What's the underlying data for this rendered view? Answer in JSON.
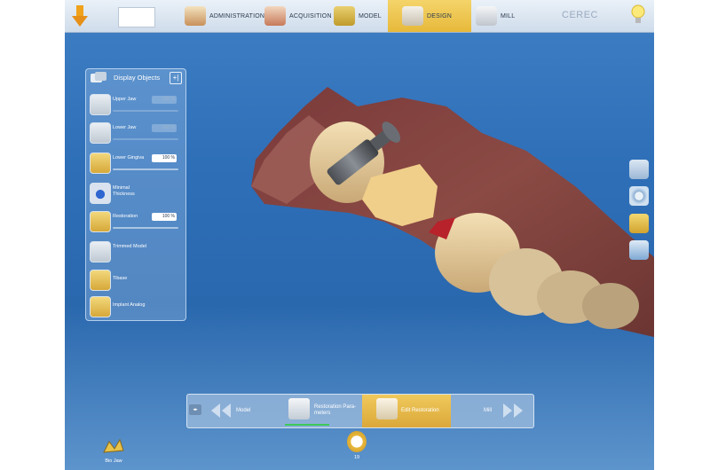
{
  "header": {
    "steps": [
      {
        "label": "ADMINISTRATION"
      },
      {
        "label": "ACQUISITION"
      },
      {
        "label": "MODEL"
      },
      {
        "label": "DESIGN"
      },
      {
        "label": "MILL"
      }
    ],
    "active_step": "DESIGN",
    "brand": "CEREC"
  },
  "panel": {
    "title": "Display Objects",
    "expand_label": "+|",
    "items": [
      {
        "label": "Upper Jaw",
        "value": "100 %",
        "enabled": false,
        "icon": "upper-jaw-icon"
      },
      {
        "label": "Lower Jaw",
        "value": "100 %",
        "enabled": false,
        "icon": "lower-jaw-icon"
      },
      {
        "label": "Lower Gingiva",
        "value": "100 %",
        "enabled": true,
        "icon": "gingiva-icon"
      },
      {
        "label": "Minimal Thickness",
        "value": "",
        "enabled": true,
        "icon": "minimal-thickness-icon"
      },
      {
        "label": "Restoration",
        "value": "100 %",
        "enabled": true,
        "icon": "restoration-icon"
      },
      {
        "label": "Trimmed Model",
        "value": "",
        "enabled": true,
        "icon": "trimmed-model-icon"
      },
      {
        "label": "Tibase",
        "value": "",
        "enabled": true,
        "icon": "tibase-icon"
      },
      {
        "label": "Implant Analog",
        "value": "",
        "enabled": true,
        "icon": "implant-analog-icon"
      }
    ]
  },
  "wizard": {
    "steps": [
      {
        "label": "Model"
      },
      {
        "label": "Restoration Para-\nmeters"
      },
      {
        "label": "Edit Restoration"
      },
      {
        "label": "Mill"
      }
    ],
    "active_step": "Edit Restoration",
    "small_button": "◂▸"
  },
  "footer": {
    "bio_jaw_label": "Bio Jaw",
    "tooth_number": "19"
  },
  "colors": {
    "accent": "#e7b93a",
    "background": "#2e6fb8",
    "progress": "#3dc85a"
  }
}
